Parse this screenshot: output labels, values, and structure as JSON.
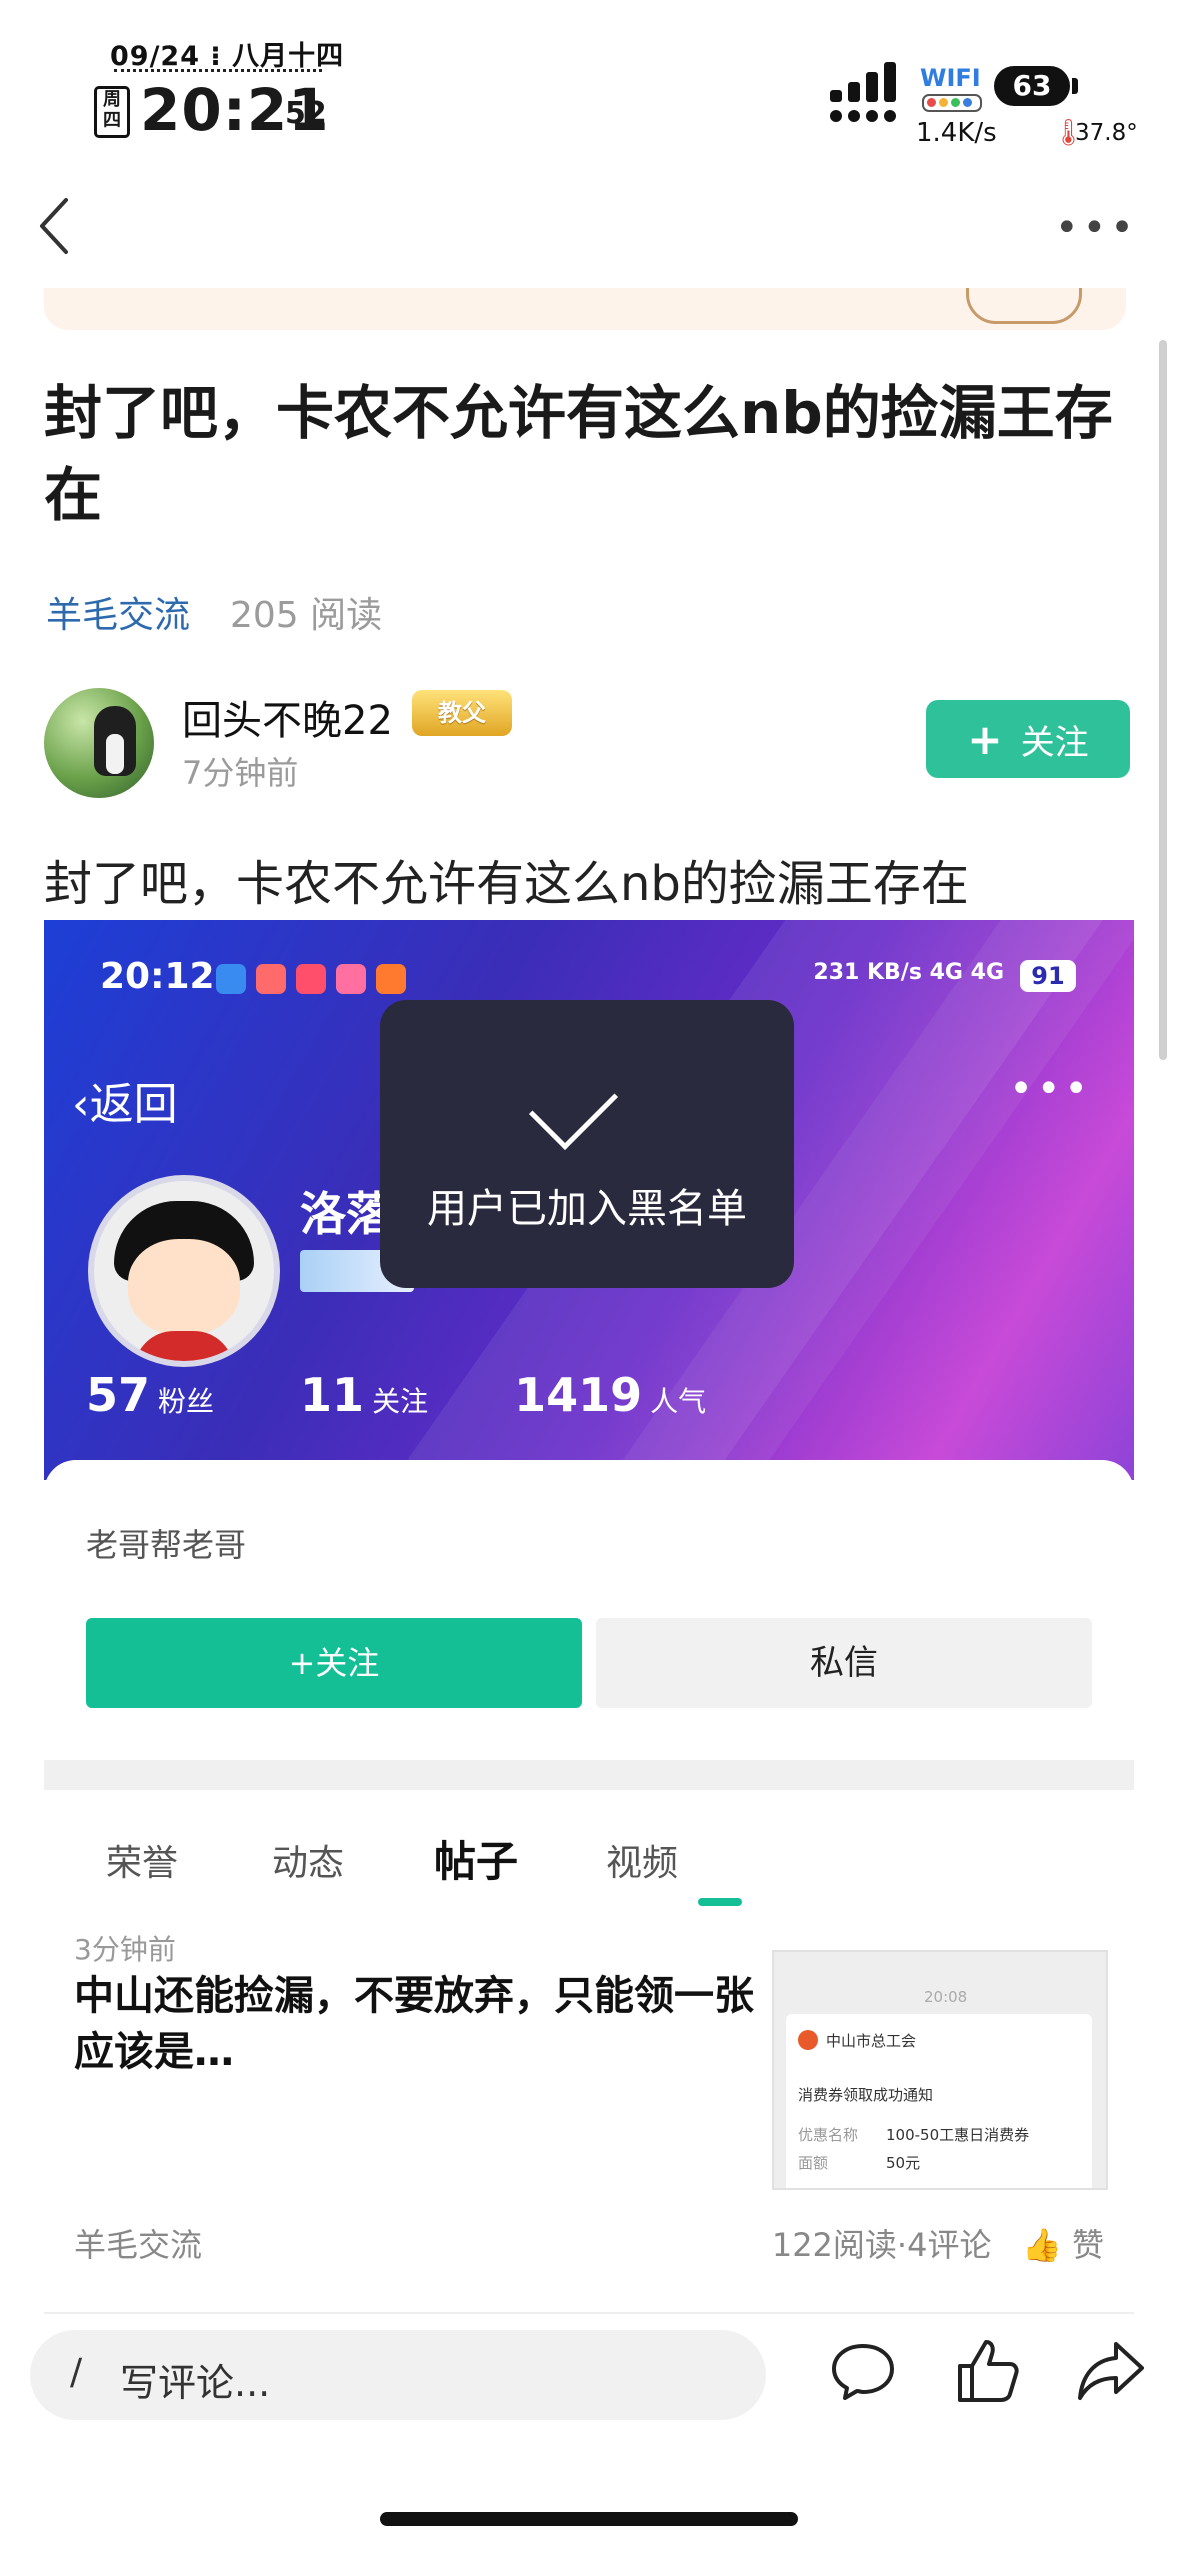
{
  "status_bar": {
    "date": "09/24 ⁝ 八月十四",
    "weekday": "周四",
    "time": "20:21",
    "seconds": "52",
    "wifi_label": "WIFI",
    "battery": "63",
    "speed": "1.4K/s",
    "temperature": "37.8°"
  },
  "nav": {
    "back_icon": "back-chevron-icon",
    "more_icon": "more-dots-icon"
  },
  "post": {
    "title": "封了吧，卡农不允许有这么nb的捡漏王存在",
    "category": "羊毛交流",
    "read_count": "205",
    "read_label": "阅读",
    "author": {
      "name": "回头不晚22",
      "badge": "教父",
      "time": "7分钟前",
      "follow_label": "关注"
    },
    "body": "封了吧，卡农不允许有这么nb的捡漏王存在"
  },
  "embedded": {
    "time": "20:12",
    "net_speed": "231 KB/s",
    "network": "4G 4G",
    "battery": "91",
    "back_label": "返回",
    "toast": "用户已加入黑名单",
    "user_name": "洛落",
    "stats": [
      {
        "value": "57",
        "label": "粉丝"
      },
      {
        "value": "11",
        "label": "关注"
      },
      {
        "value": "1419",
        "label": "人气"
      }
    ],
    "subtitle": "老哥帮老哥",
    "follow_btn": "+关注",
    "message_btn": "私信",
    "tabs": [
      "荣誉",
      "动态",
      "帖子",
      "视频"
    ],
    "active_tab": "帖子",
    "item": {
      "time": "3分钟前",
      "title": "中山还能捡漏，不要放弃，只能领一张应该是…",
      "thumb": {
        "time": "20:08",
        "org": "中山市总工会",
        "notice": "消费券领取成功通知",
        "coupon_label": "优惠名称",
        "coupon_value": "100-50工惠日消费券",
        "amount_label": "面额",
        "amount_value": "50元"
      },
      "category": "羊毛交流",
      "meta": "122阅读·4评论",
      "like_label": "赞"
    }
  },
  "bottom_bar": {
    "comment_placeholder": "写评论...",
    "icons": [
      "comment-icon",
      "like-icon",
      "share-icon"
    ]
  }
}
